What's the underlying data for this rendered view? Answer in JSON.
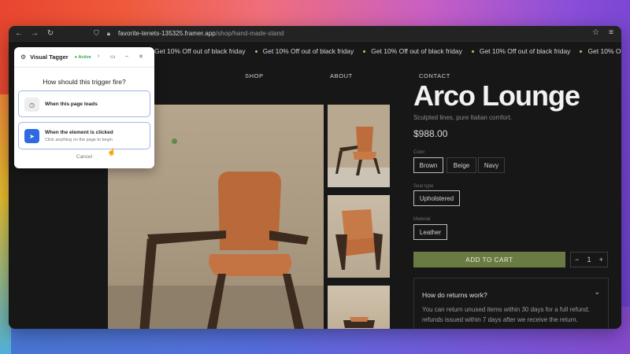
{
  "browser": {
    "url_host": "favorite-tenets-135325.framer.app",
    "url_path": "/shop/hand-made-stand"
  },
  "promo": {
    "text": "Get 10% Off out of black friday",
    "repeat": 8
  },
  "nav": {
    "shop": "SHOP",
    "about": "ABOUT",
    "contact": "CONTACT"
  },
  "product": {
    "title": "Arco Lounge",
    "subtitle": "Sculpted lines, pure Italian comfort.",
    "price": "$988.00",
    "color_label": "Color",
    "colors": [
      "Brown",
      "Beige",
      "Navy"
    ],
    "selected_color": "Brown",
    "seat_label": "Seat type",
    "seat": "Upholstered",
    "material_label": "Material",
    "material": "Leather",
    "add_to_cart": "ADD TO CART",
    "quantity": "1",
    "minus": "−",
    "plus": "+"
  },
  "faq": {
    "question": "How do returns work?",
    "answer": "You can return unused items within 30 days for a full refund; refunds issued within 7 days after we receive the return."
  },
  "tagger": {
    "name": "Visual Tagger",
    "status": "● Active",
    "question": "How should this trigger fire?",
    "option_load": "When this page loads",
    "option_click": "When the element is clicked",
    "option_click_sub": "Click anything on the page to begin",
    "cancel": "Cancel"
  },
  "colors": {
    "accent_cart": "#6a7a43",
    "tagger_active": "#2aa84a",
    "tagger_primary": "#2d6ae0"
  }
}
